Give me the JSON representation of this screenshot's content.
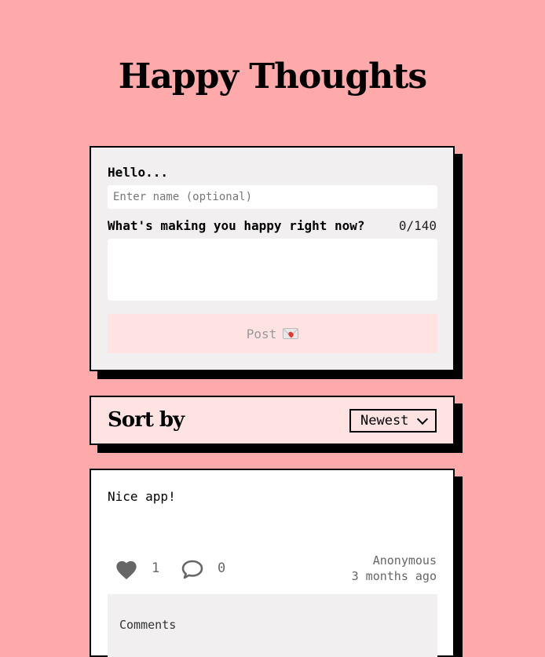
{
  "header": {
    "title": "Happy Thoughts"
  },
  "form": {
    "name_label": "Hello...",
    "name_placeholder": "Enter name (optional)",
    "name_value": "",
    "message_label": "What's making you happy right now?",
    "char_count": "0/140",
    "message_value": "",
    "post_label": "Post",
    "post_icon": "envelope-heart-icon"
  },
  "sort": {
    "label": "Sort by",
    "selected": "Newest"
  },
  "thoughts": [
    {
      "text": "Nice app!",
      "likes": "1",
      "comments_count": "0",
      "author": "Anonymous",
      "time": "3 months ago",
      "comments_title": "Comments"
    }
  ],
  "colors": {
    "background": "#ffaaaa",
    "form_card": "#f1efef",
    "sort_card": "#ffe3e3",
    "post_button": "#ffe3e3",
    "icon_gray": "#666666"
  }
}
